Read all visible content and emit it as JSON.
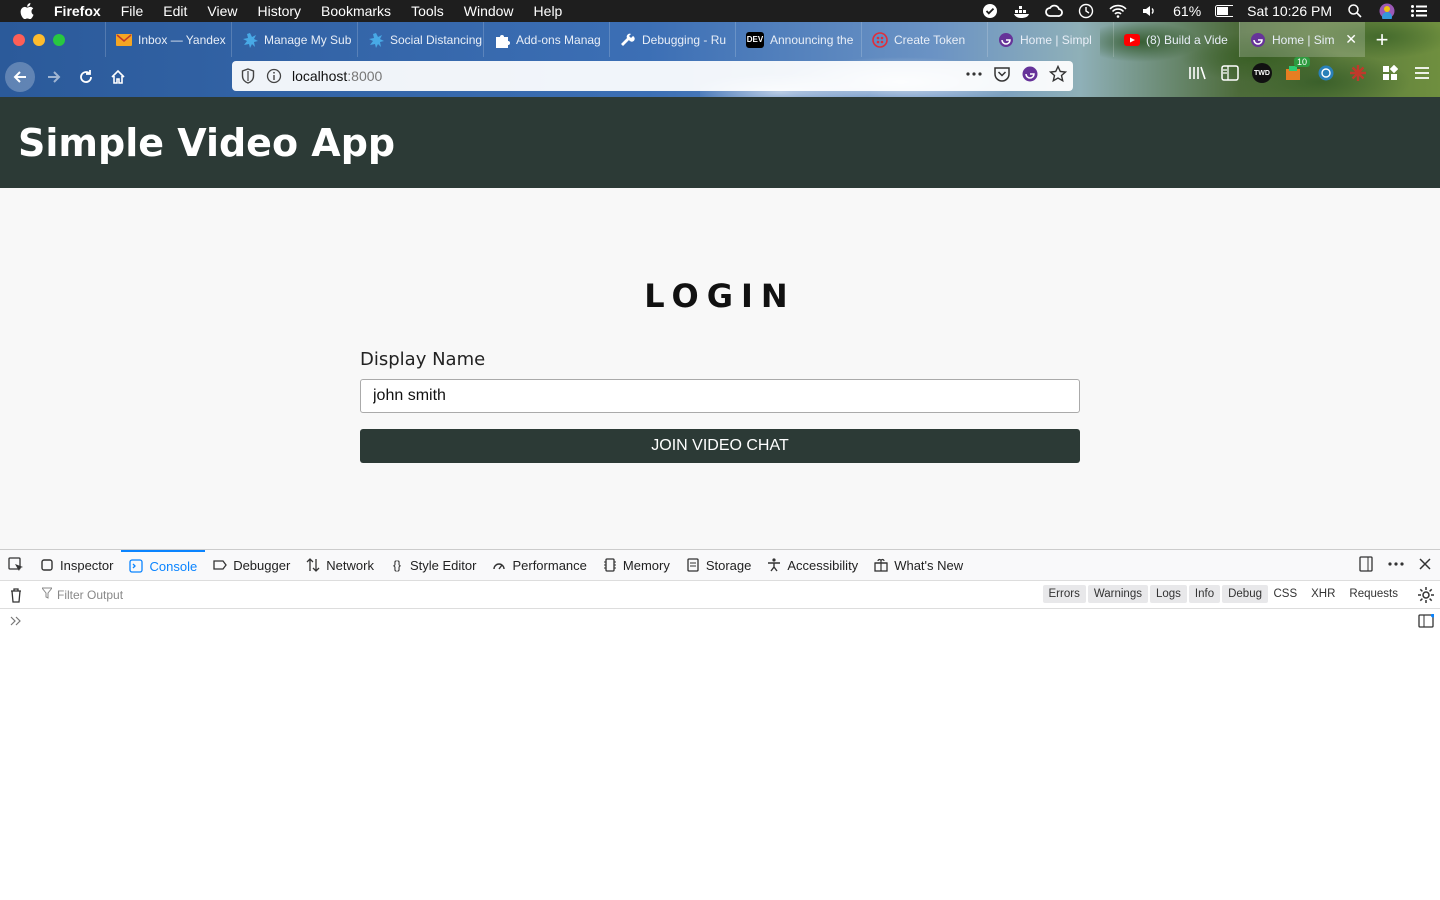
{
  "menubar": {
    "app": "Firefox",
    "items": [
      "File",
      "Edit",
      "View",
      "History",
      "Bookmarks",
      "Tools",
      "Window",
      "Help"
    ],
    "battery": "61%",
    "clock": "Sat 10:26 PM"
  },
  "tabs": [
    {
      "title": "Inbox — Yandex",
      "icon": "mail-icon",
      "color": "#f5a623"
    },
    {
      "title": "Manage My Sub",
      "icon": "gear-puzzle-icon",
      "color": "#48a9e6"
    },
    {
      "title": "Social Distancing",
      "icon": "gear-puzzle-icon",
      "color": "#48a9e6"
    },
    {
      "title": "Add-ons Manag",
      "icon": "puzzle-icon",
      "color": "#ffffff"
    },
    {
      "title": "Debugging - Ru",
      "icon": "wrench-icon",
      "color": "#ffffff"
    },
    {
      "title": "Announcing the",
      "icon": "dev-icon",
      "color": "#000000"
    },
    {
      "title": "Create Token",
      "icon": "twilio-icon",
      "color": "#e12d39"
    },
    {
      "title": "Home | Simpl",
      "icon": "gatsby-icon",
      "color": "#663399"
    },
    {
      "title": "(8) Build a Vide",
      "icon": "youtube-icon",
      "color": "#ff0000"
    },
    {
      "title": "Home | Sim",
      "icon": "gatsby-icon",
      "color": "#663399",
      "active": true
    }
  ],
  "url": {
    "host": "localhost",
    "port": ":8000"
  },
  "extension_badge": "10",
  "app": {
    "title": "Simple Video App",
    "login_heading": "LOGIN",
    "display_name_label": "Display Name",
    "display_name_value": "john smith",
    "join_button": "JOIN VIDEO CHAT"
  },
  "devtools": {
    "tabs": [
      {
        "label": "Inspector",
        "icon": "inspector-icon"
      },
      {
        "label": "Console",
        "icon": "console-icon",
        "active": true
      },
      {
        "label": "Debugger",
        "icon": "debugger-icon"
      },
      {
        "label": "Network",
        "icon": "network-icon"
      },
      {
        "label": "Style Editor",
        "icon": "braces-icon"
      },
      {
        "label": "Performance",
        "icon": "performance-icon"
      },
      {
        "label": "Memory",
        "icon": "memory-icon"
      },
      {
        "label": "Storage",
        "icon": "storage-icon"
      },
      {
        "label": "Accessibility",
        "icon": "accessibility-icon"
      },
      {
        "label": "What's New",
        "icon": "gift-icon"
      }
    ],
    "filter_placeholder": "Filter Output",
    "levels": [
      "Errors",
      "Warnings",
      "Logs",
      "Info",
      "Debug"
    ],
    "types": [
      "CSS",
      "XHR",
      "Requests"
    ]
  },
  "colors": {
    "app_header": "#2c3a36",
    "devtools_accent": "#0a84ff"
  }
}
